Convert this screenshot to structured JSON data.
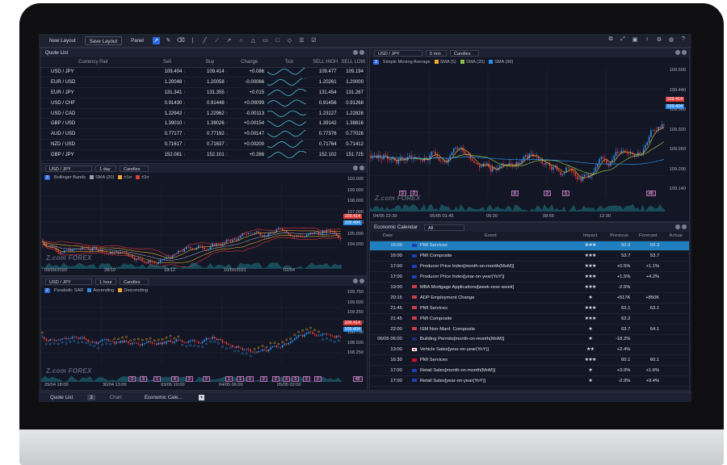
{
  "toolbar": {
    "new_layout": "New Layout",
    "save_layout": "Save Layout",
    "panel": "Panel",
    "tools": [
      "cursor",
      "pencil",
      "eraser",
      "vline",
      "line",
      "ray",
      "arrow",
      "circle",
      "triangle",
      "rect",
      "square",
      "diamond",
      "fib",
      "check"
    ]
  },
  "quote_list": {
    "title": "Quote List",
    "headers": [
      "Currency Pair",
      "Sell",
      "Buy",
      "Change",
      "Tick",
      "SELL HIGH",
      "SELL LOW"
    ],
    "rows": [
      {
        "pair": "USD / JPY",
        "sell": "109.404",
        "sell_dir": "down",
        "buy": "109.414",
        "buy_dir": "down",
        "change": "+0.086",
        "high": "109.477",
        "low": "109.194"
      },
      {
        "pair": "EUR / USD",
        "sell": "1.20048",
        "sell_dir": "up",
        "buy": "1.20058",
        "buy_dir": "up",
        "change": "-0.00066",
        "high": "1.20261",
        "low": "1.20000"
      },
      {
        "pair": "EUR / JPY",
        "sell": "131.341",
        "sell_dir": "up",
        "buy": "131.355",
        "buy_dir": "up",
        "change": "+0.015",
        "high": "131.454",
        "low": "131.267"
      },
      {
        "pair": "USD / CHF",
        "sell": "0.91430",
        "sell_dir": "down",
        "buy": "0.91448",
        "buy_dir": "up",
        "change": "+0.00099",
        "high": "0.91456",
        "low": "0.91268"
      },
      {
        "pair": "USD / CAD",
        "sell": "1.22942",
        "sell_dir": "up",
        "buy": "1.22962",
        "buy_dir": "up",
        "change": "-0.00113",
        "high": "1.23127",
        "low": "1.22828"
      },
      {
        "pair": "GBP / USD",
        "sell": "1.39010",
        "sell_dir": "up",
        "buy": "1.39026",
        "buy_dir": "up",
        "change": "+0.00154",
        "high": "1.39142",
        "low": "1.38816"
      },
      {
        "pair": "AUD / USD",
        "sell": "0.77177",
        "sell_dir": "down",
        "buy": "0.77192",
        "buy_dir": "down",
        "change": "+0.00147",
        "high": "0.77376",
        "low": "0.77026"
      },
      {
        "pair": "NZD / USD",
        "sell": "0.71617",
        "sell_dir": "down",
        "buy": "0.71637",
        "buy_dir": "down",
        "change": "+0.00200",
        "high": "0.71764",
        "low": "0.71412"
      },
      {
        "pair": "GBP / JPY",
        "sell": "152.081",
        "sell_dir": "down",
        "buy": "152.101",
        "buy_dir": "down",
        "change": "+0.286",
        "high": "152.102",
        "low": "151.725"
      }
    ]
  },
  "bb_chart": {
    "symbol": "USD / JPY",
    "period": "1 day",
    "type": "Candles",
    "badge": "3",
    "legend": [
      "Bollinger Bands",
      "SMA (20)",
      "±1σ",
      "±2σ"
    ],
    "legend_colors": [
      "#000000",
      "#9aa0ad",
      "#f0a830",
      "#e03b3b"
    ],
    "y_ticks": [
      "110.000",
      "109.000",
      "108.000",
      "107.000",
      "106.000",
      "105.000",
      "104.000"
    ],
    "x_ticks": [
      "09/09/2020",
      "28/10",
      "18/12",
      "10/02/2021",
      "02/04"
    ],
    "tag1": "109.414",
    "tag2": "109.404",
    "logo": "Z.com FOREX"
  },
  "sar_chart": {
    "symbol": "USD / JPY",
    "period": "1 hour",
    "type": "Candles",
    "badge": "2",
    "legend": [
      "Parabolic SAR",
      "Ascending",
      "Descending"
    ],
    "legend_colors": [
      "#000000",
      "#2d8de8",
      "#f0a830"
    ],
    "y_ticks": [
      "109.750",
      "109.500",
      "109.250",
      "109.000",
      "108.750",
      "108.500",
      "108.250"
    ],
    "x_ticks": [
      "29/04 18:00",
      "30/04 13:00",
      "03/05 10:00",
      "04/05 06:00",
      "05/05 02:00"
    ],
    "tag1": "109.414",
    "tag2": "109.404",
    "markers": [
      "3",
      "3",
      "1",
      "4",
      "2",
      "2",
      "1",
      "1",
      "1",
      "2",
      "2",
      "3",
      "3",
      "2",
      "2",
      "45"
    ],
    "logo": "Z.com FOREX"
  },
  "sma_chart": {
    "symbol": "USD / JPY",
    "period": "5 min",
    "type": "Candles",
    "badge": "3",
    "legend": [
      "Simple Moving Average",
      "SMA (5)",
      "SMA (20)",
      "SMA (90)"
    ],
    "legend_colors": [
      "#000000",
      "#f0a830",
      "#8bc34a",
      "#2d8de8"
    ],
    "y_ticks": [
      "109.500",
      "109.440",
      "109.380",
      "109.320",
      "109.260",
      "109.200",
      "109.140"
    ],
    "x_ticks": [
      "04/05 22:30",
      "05/05 01:45",
      "05:20",
      "08:55",
      "12:30"
    ],
    "tag1": "109.414",
    "tag2": "109.404",
    "markers": [
      "2",
      "2",
      "8",
      "2",
      "1",
      "45"
    ],
    "logo": "Z.com FOREX"
  },
  "calendar": {
    "title": "Economic Calendar",
    "filter": "All",
    "headers": [
      "Date",
      "Event",
      "Impact",
      "Previous",
      "Forecast",
      "Actual"
    ],
    "rows": [
      {
        "date": "",
        "time": "16:00",
        "flag": "eu",
        "event": "PMI Services",
        "stars": "★★★",
        "previous": "50.3",
        "forecast": "50.3",
        "actual": "",
        "selected": true
      },
      {
        "date": "",
        "time": "16:00",
        "flag": "eu",
        "event": "PMI Composite",
        "stars": "★★★",
        "previous": "53.7",
        "forecast": "53.7",
        "actual": ""
      },
      {
        "date": "",
        "time": "17:00",
        "flag": "eu",
        "event": "Producer Price Index[month-on-month(MoM)]",
        "stars": "★★★",
        "previous": "+0.5%",
        "forecast": "+1.1%",
        "actual": ""
      },
      {
        "date": "",
        "time": "17:00",
        "flag": "eu",
        "event": "Producer Price Index[year-on-year(YoY)]",
        "stars": "★★★",
        "previous": "+1.5%",
        "forecast": "+4.2%",
        "actual": ""
      },
      {
        "date": "",
        "time": "19:00",
        "flag": "us",
        "event": "MBA Mortgage Applications[week-over-week]",
        "stars": "★★★",
        "previous": "-2.5%",
        "forecast": "",
        "actual": ""
      },
      {
        "date": "",
        "time": "20:15",
        "flag": "us",
        "event": "ADP Employment Change",
        "stars": "★",
        "previous": "+517K",
        "forecast": "+850K",
        "actual": ""
      },
      {
        "date": "",
        "time": "21:45",
        "flag": "us",
        "event": "PMI Services",
        "stars": "★★★",
        "previous": "63.1",
        "forecast": "63.1",
        "actual": ""
      },
      {
        "date": "",
        "time": "21:45",
        "flag": "us",
        "event": "PMI Composite",
        "stars": "★★★",
        "previous": "62.2",
        "forecast": "",
        "actual": ""
      },
      {
        "date": "",
        "time": "22:00",
        "flag": "us",
        "event": "ISM Non-Manf. Composite",
        "stars": "★",
        "previous": "63.7",
        "forecast": "64.1",
        "actual": ""
      },
      {
        "date": "06/05",
        "time": "06:00",
        "flag": "au",
        "event": "Building Permits[month-on-month(MoM)]",
        "stars": "★",
        "previous": "-18.2%",
        "forecast": "",
        "actual": ""
      },
      {
        "date": "",
        "time": "13:00",
        "flag": "jp",
        "event": "Vehicle Sales[year-on-year(YoY)]",
        "stars": "★★",
        "previous": "+2.4%",
        "forecast": "",
        "actual": ""
      },
      {
        "date": "",
        "time": "16:30",
        "flag": "gb",
        "event": "PMI Services",
        "stars": "★★★",
        "previous": "60.1",
        "forecast": "60.1",
        "actual": ""
      },
      {
        "date": "",
        "time": "17:00",
        "flag": "eu",
        "event": "Retail Sales[month-on-month(MoM)]",
        "stars": "★",
        "previous": "+3.0%",
        "forecast": "+1.6%",
        "actual": ""
      },
      {
        "date": "",
        "time": "17:00",
        "flag": "eu",
        "event": "Retail Sales[year-on-year(YoY)]",
        "stars": "★",
        "previous": "-2.9%",
        "forecast": "+9.4%",
        "actual": ""
      }
    ]
  },
  "bottom_tabs": {
    "quote_list": "Quote List",
    "count": "3",
    "chart": "Chart",
    "economic": "Economic Cale..."
  }
}
